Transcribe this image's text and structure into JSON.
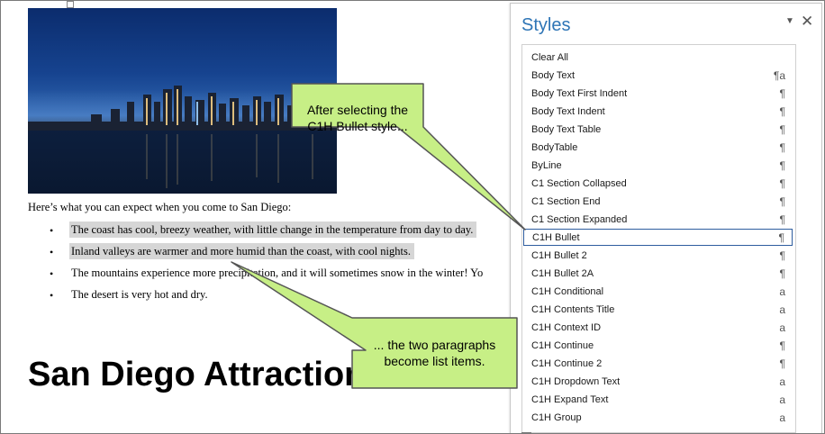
{
  "document": {
    "intro": "Here’s what you can expect when you come to San Diego:",
    "bullets": [
      {
        "text": "The coast has cool, breezy weather, with little change in the temperature from day to day.",
        "selected": true
      },
      {
        "text": "Inland valleys are warmer and more humid than the coast, with cool nights.",
        "selected": true
      },
      {
        "text": "The mountains experience more precipitation, and it will sometimes snow in the winter! Yo",
        "selected": false
      },
      {
        "text": "The desert is very hot and dry.",
        "selected": false
      }
    ],
    "bullet_char": "•",
    "heading": "San Diego Attractions"
  },
  "styles_pane": {
    "title": "Styles",
    "menu_icon": "dropdown-arrow-icon",
    "close_icon": "close-icon",
    "items": [
      {
        "name": "Clear All",
        "glyph": ""
      },
      {
        "name": "Body Text",
        "glyph": "¶a"
      },
      {
        "name": "Body Text First Indent",
        "glyph": "¶"
      },
      {
        "name": "Body Text Indent",
        "glyph": "¶"
      },
      {
        "name": "Body Text Table",
        "glyph": "¶"
      },
      {
        "name": "BodyTable",
        "glyph": "¶"
      },
      {
        "name": "ByLine",
        "glyph": "¶"
      },
      {
        "name": "C1 Section Collapsed",
        "glyph": "¶"
      },
      {
        "name": "C1 Section End",
        "glyph": "¶"
      },
      {
        "name": "C1 Section Expanded",
        "glyph": "¶"
      },
      {
        "name": "C1H Bullet",
        "glyph": "¶"
      },
      {
        "name": "C1H Bullet 2",
        "glyph": "¶"
      },
      {
        "name": "C1H Bullet 2A",
        "glyph": "¶"
      },
      {
        "name": "C1H Conditional",
        "glyph": "a"
      },
      {
        "name": "C1H Contents Title",
        "glyph": "a"
      },
      {
        "name": "C1H Context ID",
        "glyph": "a"
      },
      {
        "name": "C1H Continue",
        "glyph": "¶"
      },
      {
        "name": "C1H Continue 2",
        "glyph": "¶"
      },
      {
        "name": "C1H Dropdown Text",
        "glyph": "a"
      },
      {
        "name": "C1H Expand Text",
        "glyph": "a"
      },
      {
        "name": "C1H Group",
        "glyph": "a"
      }
    ],
    "selected_item": "C1H Bullet"
  },
  "callouts": {
    "first": {
      "line1": "After selecting the",
      "line2": "C1H Bullet style..."
    },
    "second": {
      "line1": "... the two paragraphs",
      "line2": "become list items."
    },
    "fill_color": "#c7ef86",
    "border_color": "#555555"
  }
}
